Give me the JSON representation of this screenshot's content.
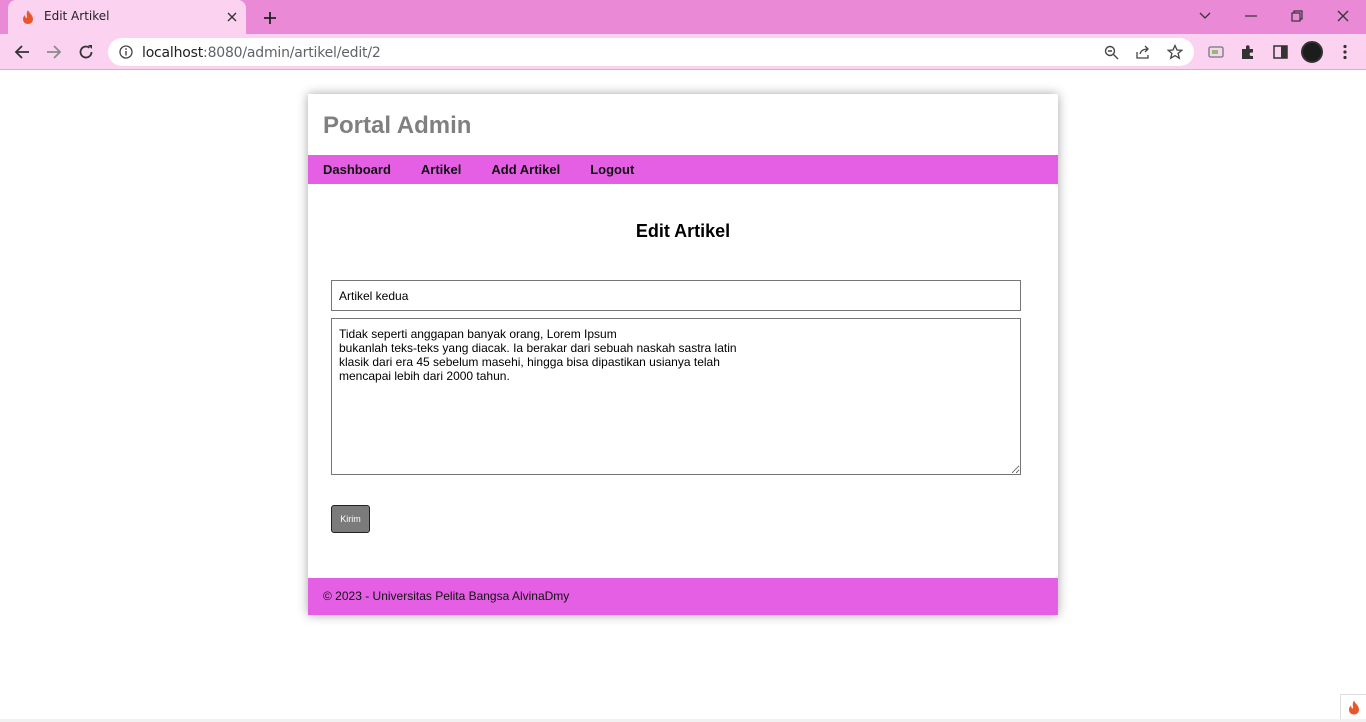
{
  "browser": {
    "tab_title": "Edit Artikel",
    "url_host": "localhost",
    "url_rest": ":8080/admin/artikel/edit/2"
  },
  "site": {
    "title": "Portal Admin",
    "nav": [
      "Dashboard",
      "Artikel",
      "Add Artikel",
      "Logout"
    ],
    "footer": "© 2023 - Universitas Pelita Bangsa AlvinaDmy"
  },
  "form": {
    "heading": "Edit Artikel",
    "title_value": "Artikel kedua",
    "body_value": "Tidak seperti anggapan banyak orang, Lorem Ipsum\nbukanlah teks-teks yang diacak. Ia berakar dari sebuah naskah sastra latin\nklasik dari era 45 sebelum masehi, hingga bisa dipastikan usianya telah\nmencapai lebih dari 2000 tahun.",
    "submit_label": "Kirim"
  },
  "colors": {
    "tabbar": "#ea8ad6",
    "toolbar": "#fbd3f1",
    "nav": "#e55fe5",
    "footer": "#e55fe5",
    "submit": "#7b7b7b"
  },
  "icons": {
    "tab_favicon": "flame-icon",
    "tab_close": "close-icon",
    "new_tab": "plus-icon",
    "back": "arrow-left-icon",
    "forward": "arrow-right-icon",
    "reload": "reload-icon",
    "site_info": "info-icon",
    "zoom": "zoom-icon",
    "share": "share-icon",
    "bookmark": "star-icon",
    "extensions": "puzzle-icon",
    "side_panel": "side-panel-icon",
    "menu": "kebab-menu-icon",
    "corner": "flame-icon"
  }
}
